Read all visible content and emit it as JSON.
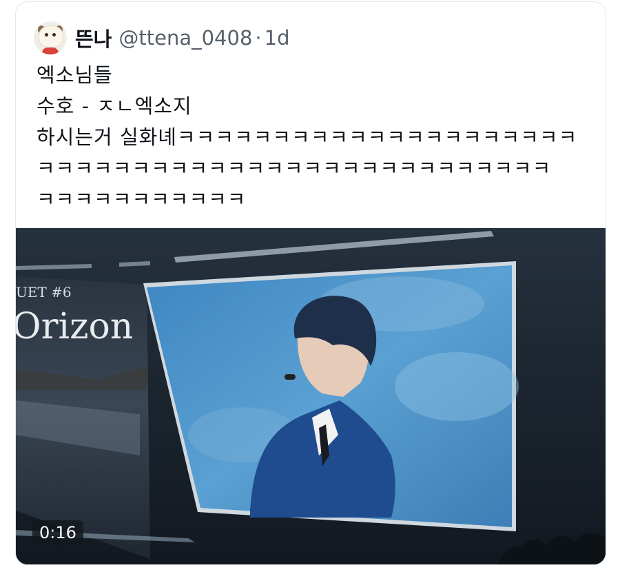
{
  "tweet": {
    "display_name": "뜬나",
    "handle": "@ttena_0408",
    "separator": "·",
    "time": "1d",
    "text": "엑소님들\n수호 - ㅈㄴ엑소지\n하시는거 실화녜ㅋㅋㅋㅋㅋㅋㅋㅋㅋㅋㅋㅋㅋㅋㅋㅋㅋㅋㅋㅋㅋ\nㅋㅋㅋㅋㅋㅋㅋㅋㅋㅋㅋㅋㅋㅋㅋㅋㅋㅋㅋㅋㅋㅋㅋㅋㅋㅋㅋ\nㅋㅋㅋㅋㅋㅋㅋㅋㅋㅋㅋ"
  },
  "media": {
    "type": "video",
    "duration": "0:16",
    "left_screen_line1": "UET #6",
    "left_screen_line2": "Orizon"
  },
  "icons": {
    "avatar": "cartoon-avatar-icon"
  },
  "colors": {
    "text": "#0f1419",
    "secondary_text": "#56606b",
    "card_border": "#e3e6ea",
    "screen_blue": "#4f93c7"
  }
}
